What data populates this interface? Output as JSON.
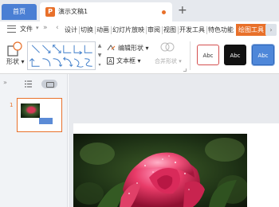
{
  "tabs": {
    "home": "首页",
    "document": "演示文稿1",
    "add": "+"
  },
  "menu": {
    "file": "文件",
    "more_left": "»",
    "items": [
      "设计",
      "切换",
      "动画",
      "幻灯片放映",
      "审阅",
      "视图",
      "开发工具",
      "特色功能"
    ],
    "active_item": "绘图工具",
    "next": "›"
  },
  "ribbon": {
    "shape_label": "形状",
    "edit_shape": "编辑形状",
    "textbox": "文本框",
    "merge_shapes": "合并形状",
    "styles": [
      "Abc",
      "Abc",
      "Abc"
    ]
  },
  "slide_pane": {
    "collapse": "»",
    "slide_number": "1"
  },
  "colors": {
    "accent": "#e8702a",
    "home_tab": "#4a7fd4",
    "selected_style": "#4e87d9"
  },
  "icons": [
    "menu-icon",
    "shape-icon",
    "edit-shape-icon",
    "textbox-icon",
    "merge-shapes-icon",
    "outline-view-icon",
    "slides-view-icon"
  ]
}
